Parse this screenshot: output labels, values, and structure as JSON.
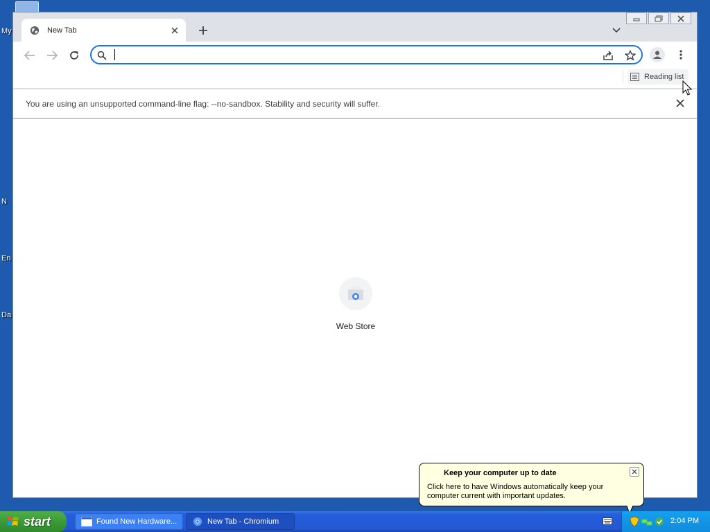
{
  "desktop": {
    "icon_labels": [
      "My",
      "N",
      "En",
      "Da"
    ]
  },
  "browser": {
    "tab": {
      "title": "New Tab"
    },
    "omnibox": {
      "value": "",
      "placeholder": ""
    },
    "bookmarks": {
      "reading_list_label": "Reading list"
    },
    "infobar": {
      "message": "You are using an unsupported command-line flag: --no-sandbox. Stability and security will suffer."
    },
    "ntp": {
      "shortcut_label": "Web Store"
    }
  },
  "balloon": {
    "title": "Keep your computer up to date",
    "body": "Click here to have Windows automatically keep your computer current with important updates."
  },
  "taskbar": {
    "start_label": "start",
    "tasks": [
      {
        "label": "Found New Hardware..."
      },
      {
        "label": "New Tab - Chromium"
      }
    ],
    "clock": "2:04 PM"
  },
  "colors": {
    "accent": "#1a73e8",
    "desktop": "#1e5aad",
    "taskbar": "#245edb",
    "start": "#3c9a38"
  }
}
